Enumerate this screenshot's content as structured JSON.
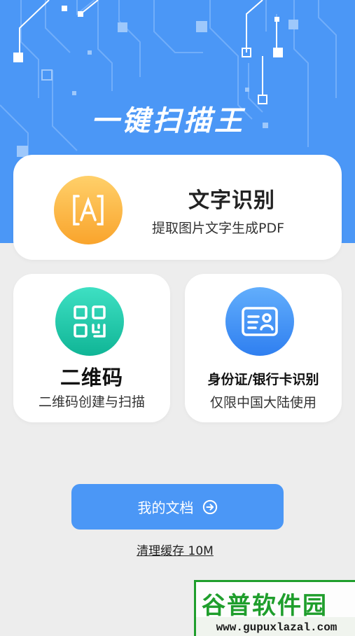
{
  "app": {
    "title": "一键扫描王"
  },
  "cards": {
    "ocr": {
      "icon": "text-recognition-icon",
      "title": "文字识别",
      "subtitle": "提取图片文字生成PDF"
    },
    "qr": {
      "icon": "qr-code-icon",
      "title": "二维码",
      "subtitle": "二维码创建与扫描"
    },
    "id": {
      "icon": "id-card-icon",
      "title": "身份证/银行卡识别",
      "subtitle": "仅限中国大陆使用"
    }
  },
  "actions": {
    "my_documents_label": "我的文档",
    "my_documents_icon": "arrow-right-circle-icon",
    "clear_cache_label": "清理缓存  10M"
  },
  "watermark": {
    "brand": "谷普软件园",
    "url": "www.gupuxlazal.com"
  },
  "colors": {
    "primary": "#4b97f6",
    "ocr_icon": "#f9a42c",
    "qr_icon": "#10b596",
    "id_icon": "#2f7ff0",
    "background": "#ededed"
  }
}
